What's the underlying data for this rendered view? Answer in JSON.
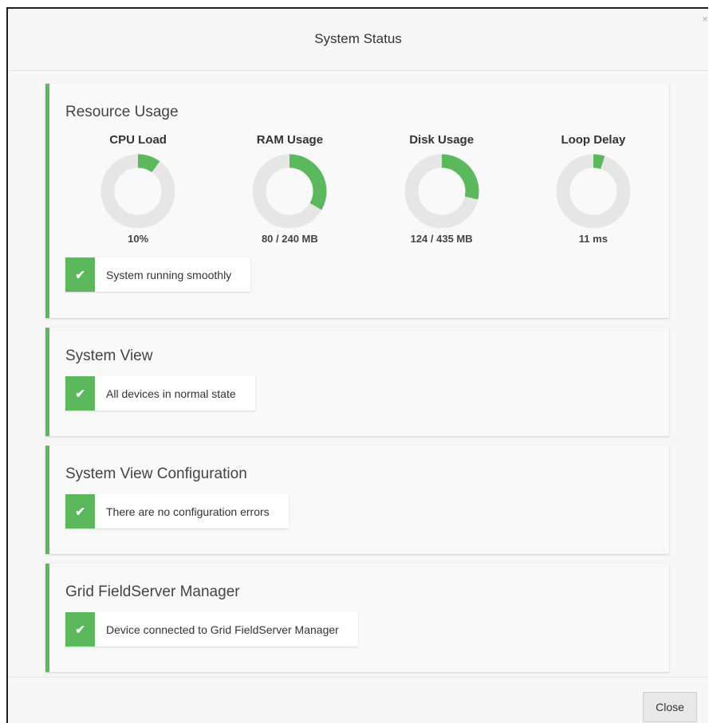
{
  "dialog": {
    "title": "System Status",
    "close_icon": "×",
    "close_button": "Close"
  },
  "colors": {
    "accent": "#5cb85c",
    "track": "#e6e6e6"
  },
  "resource": {
    "title": "Resource Usage",
    "gauges": [
      {
        "label": "CPU Load",
        "value": "10%",
        "fraction": 0.1
      },
      {
        "label": "RAM Usage",
        "value": "80 / 240 MB",
        "fraction": 0.333
      },
      {
        "label": "Disk Usage",
        "value": "124 / 435 MB",
        "fraction": 0.285
      },
      {
        "label": "Loop Delay",
        "value": "11 ms",
        "fraction": 0.05
      }
    ],
    "status": {
      "icon": "check-icon",
      "text": "System running smoothly"
    }
  },
  "system_view": {
    "title": "System View",
    "status": {
      "icon": "check-icon",
      "text": "All devices in normal state"
    }
  },
  "system_view_config": {
    "title": "System View Configuration",
    "status": {
      "icon": "check-icon",
      "text": "There are no configuration errors"
    }
  },
  "grid_manager": {
    "title": "Grid FieldServer Manager",
    "status": {
      "icon": "check-icon",
      "text": "Device connected to Grid FieldServer Manager"
    }
  }
}
